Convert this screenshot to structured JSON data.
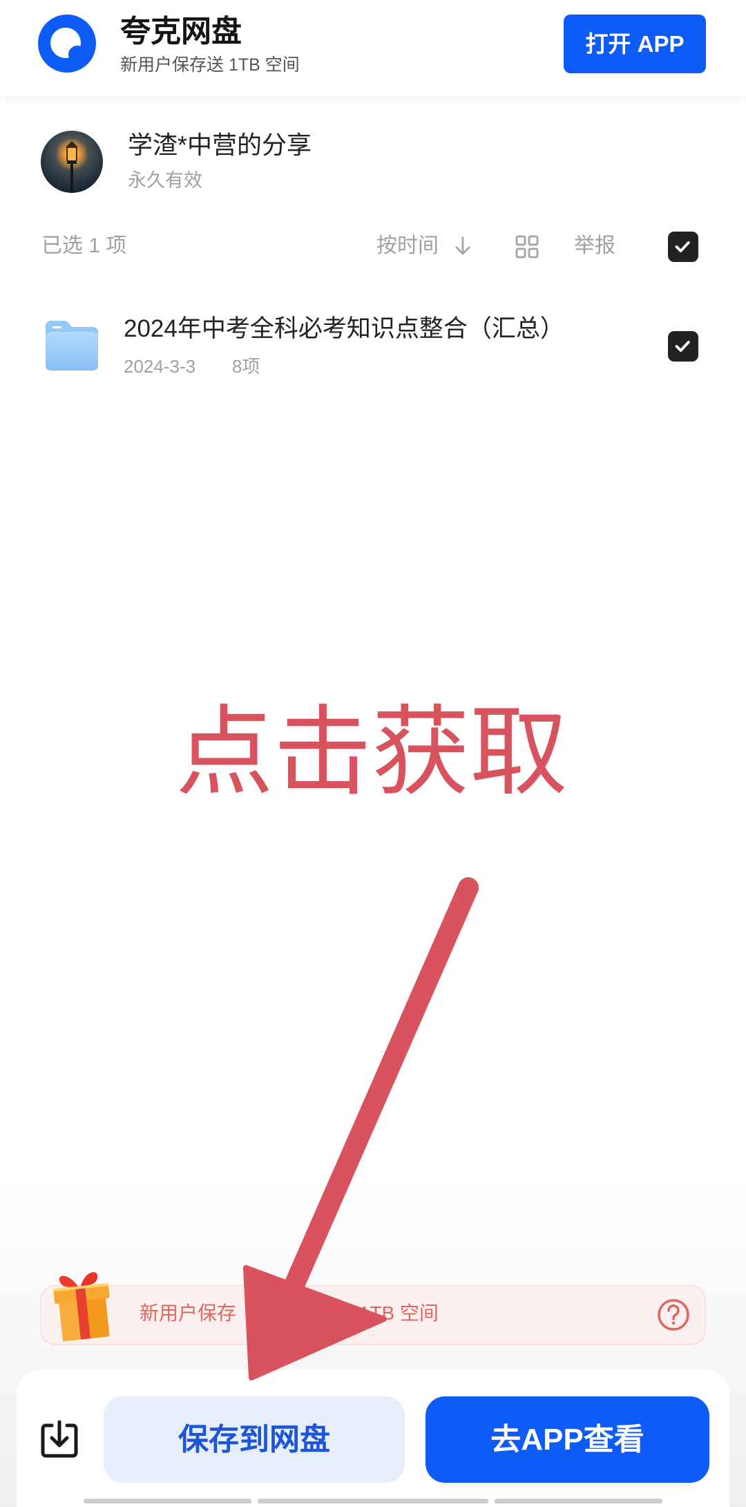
{
  "colors": {
    "brand": "#0d5cf7",
    "text_primary": "#1a1a1a",
    "text_secondary": "#a0a0a0",
    "overlay_red": "#d9535e",
    "save_bg": "#e6eefc",
    "save_text": "#1c55d6",
    "promo_bg": "#fdf0f0",
    "promo_text": "#e0665e"
  },
  "header": {
    "logo_icon": "quark-logo-icon",
    "app_name": "夸克网盘",
    "tagline": "新用户保存送 1TB 空间",
    "open_app_label": "打开 APP"
  },
  "share": {
    "avatar_icon": "street-lamp-avatar",
    "owner": "学渣*中营的分享",
    "validity": "永久有效"
  },
  "toolbar": {
    "selected_count": "已选 1 项",
    "sort_label": "按时间",
    "sort_icon": "arrow-down-icon",
    "grid_icon": "grid-view-icon",
    "report_label": "举报",
    "select_all_checked": true
  },
  "files": [
    {
      "icon": "folder-icon",
      "name": "2024年中考全科必考知识点整合（汇总）",
      "date": "2024-3-3",
      "count": "8项",
      "checked": true
    }
  ],
  "overlay": {
    "callout": "点击获取",
    "arrow_icon": "red-annotation-arrow"
  },
  "promo": {
    "gift_icon": "gift-icon",
    "text_start": "新用户保存",
    "text_end": "立享 1TB 空间",
    "help_icon": "question-circle-icon"
  },
  "actions": {
    "download_icon": "download-icon",
    "save_label": "保存到网盘",
    "open_label": "去APP查看"
  }
}
